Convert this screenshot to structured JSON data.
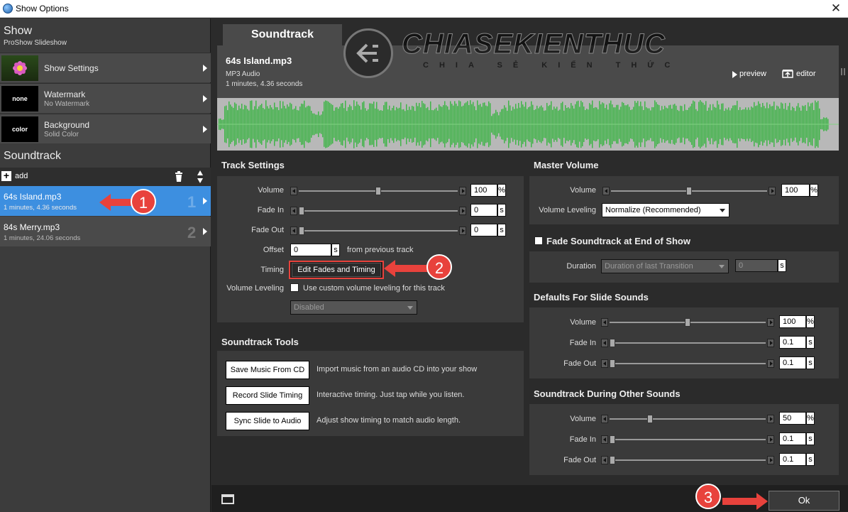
{
  "window": {
    "title": "Show Options",
    "close_glyph": "✕"
  },
  "sidebar": {
    "show_title": "Show",
    "show_subtitle": "ProShow Slideshow",
    "items": [
      {
        "label": "Show Settings",
        "sublabel": "",
        "thumb": ""
      },
      {
        "label": "Watermark",
        "sublabel": "No Watermark",
        "thumb": "none"
      },
      {
        "label": "Background",
        "sublabel": "Solid Color",
        "thumb": "color"
      }
    ],
    "soundtrack_heading": "Soundtrack",
    "add_label": "add",
    "tracks": [
      {
        "name": "64s Island.mp3",
        "detail": "1 minutes, 4.36 seconds",
        "num": "1",
        "selected": true
      },
      {
        "name": "84s Merry.mp3",
        "detail": "1 minutes, 24.06 seconds",
        "num": "2",
        "selected": false
      }
    ]
  },
  "main": {
    "tab": "Soundtrack",
    "file": {
      "name": "64s Island.mp3",
      "type": "MP3 Audio",
      "duration": "1 minutes, 4.36 seconds"
    },
    "preview_label": "preview",
    "editor_label": "editor",
    "watermark_text": {
      "big": "CHIASEKIENTHUC",
      "small": "CHIA SẺ KIẾN THỨC"
    },
    "track_settings": {
      "title": "Track Settings",
      "volume_label": "Volume",
      "volume_value": "100",
      "volume_unit": "%",
      "volume_level": 0.5,
      "fadein_label": "Fade In",
      "fadein_value": "0",
      "fadein_unit": "s",
      "fadein_level": 0,
      "fadeout_label": "Fade Out",
      "fadeout_value": "0",
      "fadeout_unit": "s",
      "fadeout_level": 0,
      "offset_label": "Offset",
      "offset_value": "0",
      "offset_unit": "s",
      "offset_suffix": "from previous track",
      "timing_label": "Timing",
      "timing_button": "Edit Fades and Timing",
      "leveling_label": "Volume Leveling",
      "leveling_checkbox": "Use custom volume leveling for this track",
      "leveling_select": "Disabled"
    },
    "tools": {
      "title": "Soundtrack Tools",
      "items": [
        {
          "button": "Save Music From CD",
          "desc": "Import music from an audio CD into your show"
        },
        {
          "button": "Record Slide Timing",
          "desc": "Interactive timing. Just tap while you listen."
        },
        {
          "button": "Sync Slide to Audio",
          "desc": "Adjust show timing to match audio length."
        }
      ]
    },
    "master": {
      "title": "Master Volume",
      "volume_label": "Volume",
      "volume_value": "100",
      "volume_unit": "%",
      "volume_level": 0.5,
      "leveling_label": "Volume Leveling",
      "leveling_select": "Normalize (Recommended)"
    },
    "fade_end": {
      "title": "Fade Soundtrack at End of Show",
      "duration_label": "Duration",
      "duration_select": "Duration of last Transition",
      "duration_value": "0",
      "duration_unit": "s"
    },
    "defaults": {
      "title": "Defaults For Slide Sounds",
      "volume_label": "Volume",
      "volume_value": "100",
      "volume_unit": "%",
      "volume_level": 0.5,
      "fadein_label": "Fade In",
      "fadein_value": "0.1",
      "fadein_unit": "s",
      "fadein_level": 0,
      "fadeout_label": "Fade Out",
      "fadeout_value": "0.1",
      "fadeout_unit": "s",
      "fadeout_level": 0
    },
    "during": {
      "title": "Soundtrack During Other Sounds",
      "volume_label": "Volume",
      "volume_value": "50",
      "volume_unit": "%",
      "volume_level": 0.25,
      "fadein_label": "Fade In",
      "fadein_value": "0.1",
      "fadein_unit": "s",
      "fadein_level": 0,
      "fadeout_label": "Fade Out",
      "fadeout_value": "0.1",
      "fadeout_unit": "s",
      "fadeout_level": 0
    },
    "ok_label": "Ok"
  },
  "callouts": [
    "1",
    "2",
    "3"
  ],
  "colors": {
    "selected": "#3d8fe0",
    "waveform": "#3fb548",
    "callout": "#e8423c"
  }
}
